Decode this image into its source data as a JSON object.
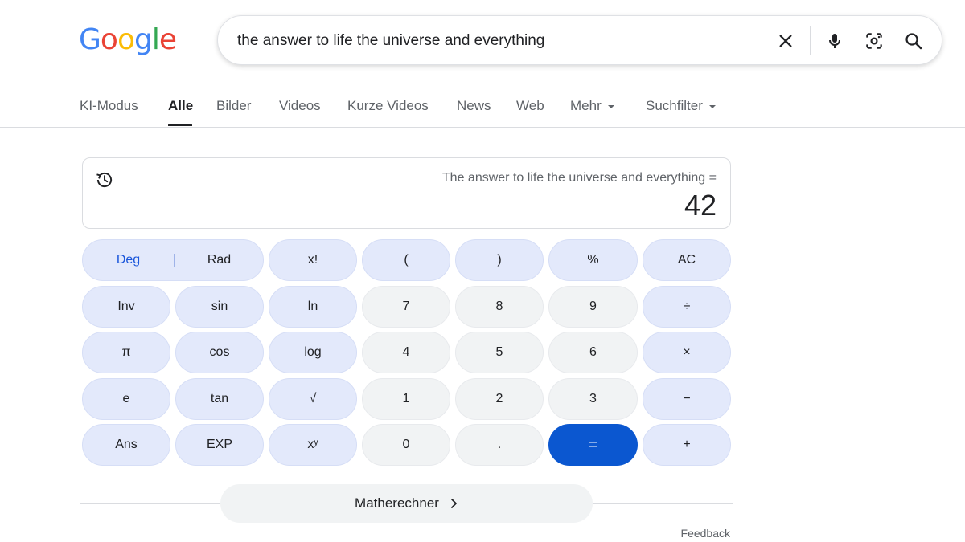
{
  "logo": {
    "letters": [
      "G",
      "o",
      "o",
      "g",
      "l",
      "e"
    ],
    "colors": [
      "#4285f4",
      "#ea4335",
      "#fbbc05",
      "#4285f4",
      "#34a853",
      "#ea4335"
    ]
  },
  "search": {
    "query": "the answer to life the universe and everything"
  },
  "tabs": [
    {
      "label": "KI-Modus"
    },
    {
      "label": "Alle",
      "active": true
    },
    {
      "label": "Bilder"
    },
    {
      "label": "Videos"
    },
    {
      "label": "Kurze Videos"
    },
    {
      "label": "News"
    },
    {
      "label": "Web"
    },
    {
      "label": "Mehr",
      "dropdown": true
    },
    {
      "label": "Suchfilter",
      "dropdown": true
    }
  ],
  "calculator": {
    "expression": "The answer to life the universe and everything =",
    "result": "42",
    "angle_mode": {
      "deg": "Deg",
      "rad": "Rad",
      "selected": "Deg"
    },
    "keys": {
      "fact": "x!",
      "lparen": "(",
      "rparen": ")",
      "percent": "%",
      "ac": "AC",
      "inv": "Inv",
      "sin": "sin",
      "ln": "ln",
      "k7": "7",
      "k8": "8",
      "k9": "9",
      "div": "÷",
      "pi": "π",
      "cos": "cos",
      "log": "log",
      "k4": "4",
      "k5": "5",
      "k6": "6",
      "mul": "×",
      "e": "e",
      "tan": "tan",
      "sqrt": "√",
      "k1": "1",
      "k2": "2",
      "k3": "3",
      "minus": "−",
      "ans": "Ans",
      "exp": "EXP",
      "pow": "xʸ",
      "k0": "0",
      "dot": ".",
      "eq": "=",
      "plus": "+"
    },
    "colors": {
      "function_key": "#e3e9fb",
      "number_key": "#f1f3f4",
      "equals_key": "#0b57d0",
      "accent": "#1a56db"
    }
  },
  "more_button": {
    "label": "Matherechner"
  },
  "feedback": {
    "label": "Feedback"
  }
}
